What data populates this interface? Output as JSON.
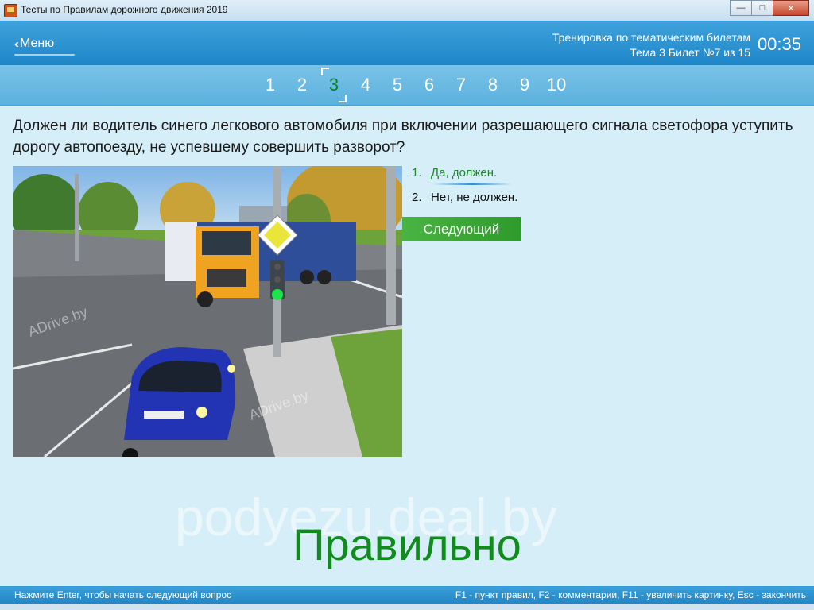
{
  "window": {
    "title": "Тесты по Правилам дорожного движения 2019"
  },
  "header": {
    "menu_label": "Меню",
    "mode": "Тренировка по тематическим билетам",
    "ticket_info": "Тема 3 Билет №7 из 15",
    "timer": "00:35"
  },
  "nav": {
    "questions": [
      "1",
      "2",
      "3",
      "4",
      "5",
      "6",
      "7",
      "8",
      "9",
      "10"
    ],
    "current": "3"
  },
  "question": {
    "text": "Должен ли водитель синего легкового автомобиля при включении разрешающего сигнала светофора уступить дорогу автопоезду, не успевшему совершить разворот?"
  },
  "answers": [
    {
      "num": "1.",
      "text": "Да, должен."
    },
    {
      "num": "2.",
      "text": "Нет, не должен."
    }
  ],
  "next_button": "Следующий",
  "image_watermarks": [
    "ADrive.by",
    "ADrive.by"
  ],
  "result": "Правильно",
  "watermark": "podyezu.deal.by",
  "status": {
    "left": "Нажмите Enter, чтобы начать следующий вопрос",
    "right": "F1 - пункт правил, F2 - комментарии, F11 - увеличить картинку, Esc - закончить"
  },
  "colors": {
    "header": "#1e86c8",
    "correct": "#1a8a2a",
    "next": "#3aa636"
  }
}
